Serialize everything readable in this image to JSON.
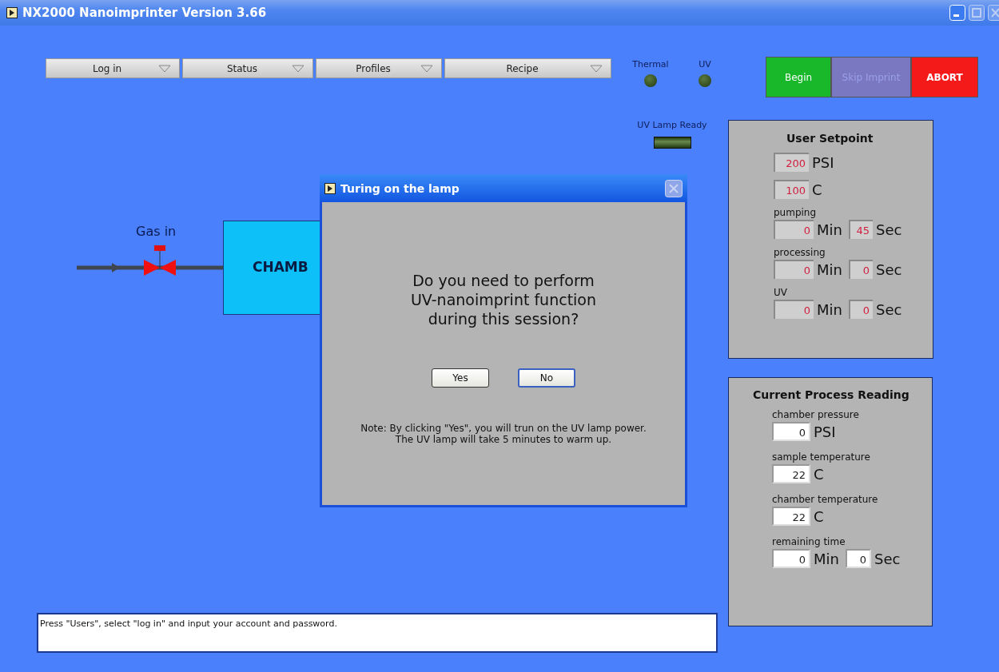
{
  "window": {
    "title": "NX2000 Nanoimprinter Version 3.66"
  },
  "menus": [
    {
      "label": "Log in"
    },
    {
      "label": "Status"
    },
    {
      "label": "Profiles"
    },
    {
      "label": "Recipe"
    }
  ],
  "indicators": [
    {
      "label": "Thermal",
      "on": false
    },
    {
      "label": "UV",
      "on": false
    }
  ],
  "actions": [
    {
      "label": "Begin",
      "kind": "go",
      "disabled": false
    },
    {
      "label": "Skip Imprint",
      "kind": "neutral",
      "disabled": true
    },
    {
      "label": "ABORT",
      "kind": "stop",
      "disabled": false
    }
  ],
  "lamp_ready": {
    "label": "UV Lamp Ready",
    "on": false
  },
  "diagram": {
    "valve_label": "Gas in",
    "chamber_label": "CHAMB"
  },
  "setpoint": {
    "title": "User Setpoint",
    "rows": [
      {
        "fields": [
          {
            "value": "200",
            "unit": "PSI"
          }
        ]
      },
      {
        "fields": [
          {
            "value": "100",
            "unit": "C"
          }
        ]
      },
      {
        "label": "pumping",
        "fields": [
          {
            "value": "0",
            "unit": "Min"
          },
          {
            "value": "45",
            "unit": "Sec"
          }
        ]
      },
      {
        "label": "processing",
        "fields": [
          {
            "value": "0",
            "unit": "Min"
          },
          {
            "value": "0",
            "unit": "Sec"
          }
        ]
      },
      {
        "label": "UV",
        "fields": [
          {
            "value": "0",
            "unit": "Min"
          },
          {
            "value": "0",
            "unit": "Sec"
          }
        ]
      }
    ]
  },
  "reading": {
    "title": "Current Process Reading",
    "rows": [
      {
        "label": "chamber pressure",
        "fields": [
          {
            "value": "0",
            "unit": "PSI"
          }
        ]
      },
      {
        "label": "sample temperature",
        "fields": [
          {
            "value": "22",
            "unit": "C"
          }
        ]
      },
      {
        "label": "chamber temperature",
        "fields": [
          {
            "value": "22",
            "unit": "C"
          }
        ]
      },
      {
        "label": "remaining time",
        "fields": [
          {
            "value": "0",
            "unit": "Min"
          },
          {
            "value": "0",
            "unit": "Sec"
          }
        ]
      }
    ]
  },
  "message": "Press \"Users\", select \"log in\" and input your account and password.",
  "dialog": {
    "title": "Turing on the lamp",
    "close_disabled": true,
    "question": [
      "Do you need to perform",
      "UV-nanoimprint function",
      "during this session?"
    ],
    "buttons": [
      {
        "label": "Yes",
        "focused": false
      },
      {
        "label": "No",
        "focused": true
      }
    ],
    "note": [
      "Note: By clicking \"Yes\", you will trun on the UV lamp power.",
      "The UV lamp will take 5 minutes to warm up."
    ]
  }
}
